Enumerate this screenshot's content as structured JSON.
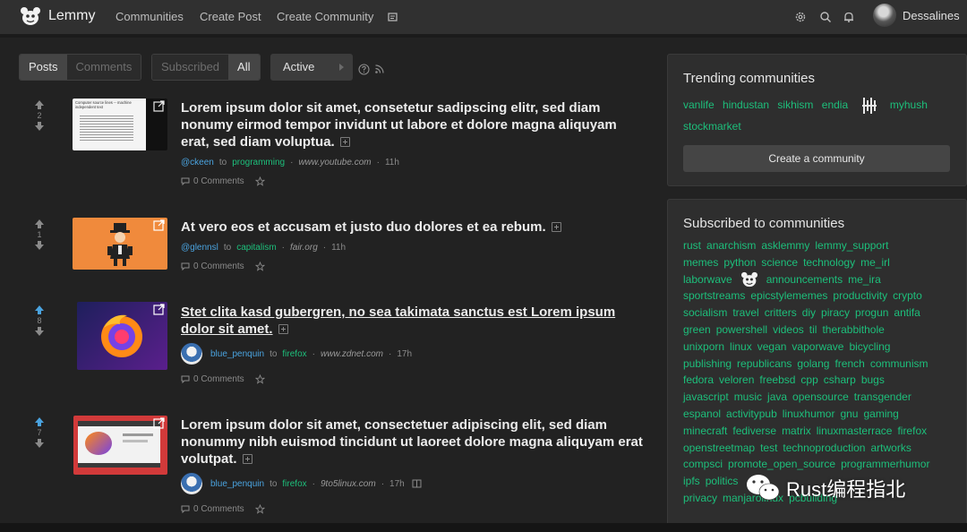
{
  "app": {
    "name": "Lemmy"
  },
  "nav": {
    "links": [
      "Communities",
      "Create Post",
      "Create Community"
    ],
    "user": "Dessalines"
  },
  "filters": {
    "type": [
      "Posts",
      "Comments"
    ],
    "listing": [
      "Subscribed",
      "All"
    ],
    "sort": "Active"
  },
  "posts": [
    {
      "score": "2",
      "title": "Lorem ipsum dolor sit amet, consetetur sadipscing elitr, sed diam nonumy eirmod tempor invidunt ut labore et dolore magna aliquyam erat, sed diam voluptua.",
      "user": "@ckeen",
      "to": "to",
      "community": "programming",
      "domain": "www.youtube.com",
      "time": "11h",
      "comments": "0 Comments",
      "thumb_text": [
        "Computer source lines -- machine",
        "independent text"
      ]
    },
    {
      "score": "1",
      "title": "At vero eos et accusam et justo duo dolores et ea rebum.",
      "user": "@glennsl",
      "to": "to",
      "community": "capitalism",
      "domain": "fair.org",
      "time": "11h",
      "comments": "0 Comments"
    },
    {
      "score": "8",
      "title": "Stet clita kasd gubergren, no sea takimata sanctus est Lorem ipsum dolor sit amet.",
      "user": "blue_penquin",
      "to": "to",
      "community": "firefox",
      "domain": "www.zdnet.com",
      "time": "17h",
      "comments": "0 Comments"
    },
    {
      "score": "7",
      "title": "Lorem ipsum dolor sit amet, consectetuer adipiscing elit, sed diam nonummy nibh euismod tincidunt ut laoreet dolore magna aliquyam erat volutpat.",
      "user": "blue_penquin",
      "to": "to",
      "community": "firefox",
      "domain": "9to5linux.com",
      "time": "17h",
      "comments": "0 Comments"
    }
  ],
  "trending": {
    "title": "Trending communities",
    "communities": [
      "vanlife",
      "hindustan",
      "sikhism",
      "endia",
      "myhush",
      "stockmarket"
    ],
    "create_label": "Create a community"
  },
  "subscribed": {
    "title": "Subscribed to communities",
    "lines": [
      [
        "rust",
        "anarchism",
        "asklemmy",
        "lemmy_support"
      ],
      [
        "memes",
        "python",
        "science",
        "technology",
        "me_irl"
      ],
      [
        "laborwave",
        "announcements",
        "me_ira"
      ],
      [
        "sportstreams",
        "epicstylememes",
        "productivity",
        "crypto"
      ],
      [
        "socialism",
        "travel",
        "critters",
        "diy",
        "piracy",
        "progun",
        "antifa"
      ],
      [
        "green",
        "powershell",
        "videos",
        "til",
        "therabbithole"
      ],
      [
        "unixporn",
        "linux",
        "vegan",
        "vaporwave",
        "bicycling"
      ],
      [
        "publishing",
        "republicans",
        "golang",
        "french",
        "communism"
      ],
      [
        "fedora",
        "veloren",
        "freebsd",
        "cpp",
        "csharp",
        "bugs"
      ],
      [
        "javascript",
        "music",
        "java",
        "opensource",
        "transgender"
      ],
      [
        "espanol",
        "activitypub",
        "linuxhumor",
        "gnu",
        "gaming"
      ],
      [
        "minecraft",
        "fediverse",
        "matrix",
        "linuxmasterrace",
        "firefox"
      ],
      [
        "openstreetmap",
        "test",
        "technoproduction",
        "artworks"
      ],
      [
        "compsci",
        "promote_open_source",
        "programmerhumor"
      ],
      [
        "ipfs",
        "politics"
      ],
      [
        "privacy",
        "manjarolinux",
        "pcbuilding"
      ]
    ]
  },
  "watermark": {
    "text": "Rust编程指北"
  },
  "colors": {
    "accent_green": "#1dbf7b",
    "link_blue": "#4aa3df",
    "upvoted": "#4aa3df"
  }
}
